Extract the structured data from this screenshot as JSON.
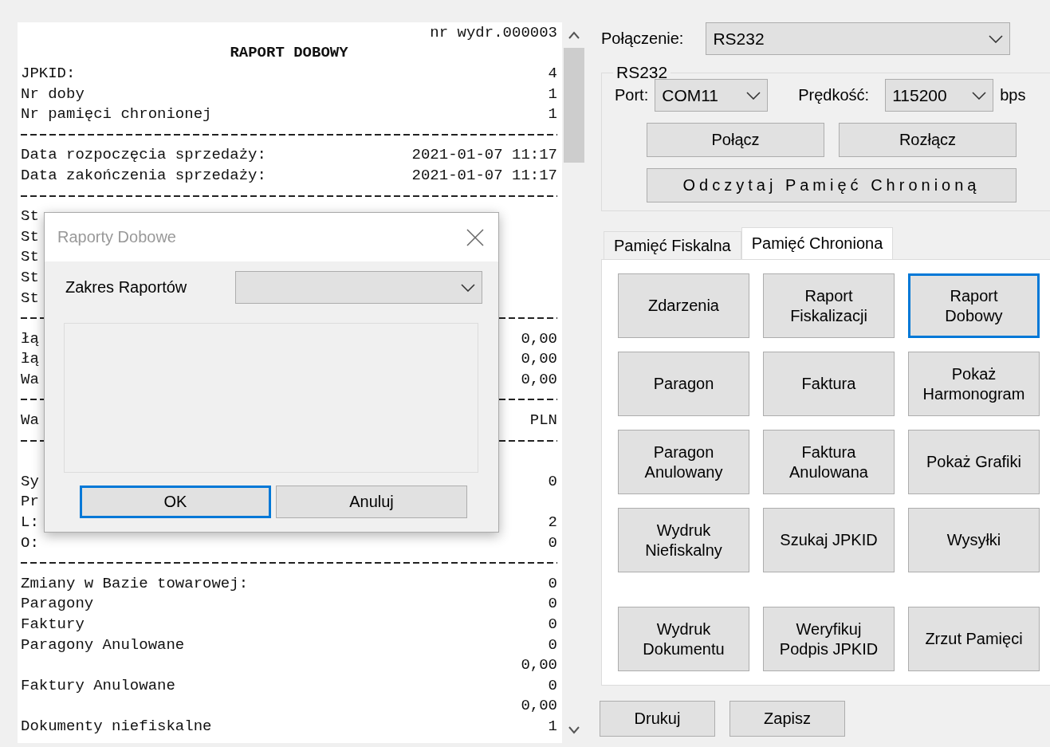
{
  "receipt": {
    "rows": [
      {
        "kind": "right",
        "label": "",
        "value": "nr wydr.000003"
      },
      {
        "kind": "center",
        "label": "RAPORT DOBOWY",
        "value": ""
      },
      {
        "kind": "line",
        "label": "JPKID:",
        "value": "4"
      },
      {
        "kind": "line",
        "label": "Nr doby",
        "value": "1"
      },
      {
        "kind": "line",
        "label": "Nr pamięci chronionej",
        "value": "1"
      },
      {
        "kind": "rule"
      },
      {
        "kind": "line",
        "label": "Data rozpoczęcia sprzedaży:",
        "value": "2021-01-07 11:17"
      },
      {
        "kind": "line",
        "label": "Data zakończenia sprzedaży:",
        "value": "2021-01-07 11:17"
      },
      {
        "kind": "rule"
      },
      {
        "kind": "line",
        "label": "St",
        "value": ""
      },
      {
        "kind": "line",
        "label": "St",
        "value": ""
      },
      {
        "kind": "line",
        "label": "St",
        "value": ""
      },
      {
        "kind": "line",
        "label": "St",
        "value": ""
      },
      {
        "kind": "line",
        "label": "St",
        "value": ""
      },
      {
        "kind": "rule"
      },
      {
        "kind": "line",
        "label": "łą",
        "value": "0,00"
      },
      {
        "kind": "line",
        "label": "łą",
        "value": "0,00"
      },
      {
        "kind": "line",
        "label": "Wa",
        "value": "0,00"
      },
      {
        "kind": "rule"
      },
      {
        "kind": "line",
        "label": "Wa",
        "value": "PLN"
      },
      {
        "kind": "rule"
      },
      {
        "kind": "blank"
      },
      {
        "kind": "line",
        "label": "Sy",
        "value": "0"
      },
      {
        "kind": "line",
        "label": "Pr",
        "value": ""
      },
      {
        "kind": "line",
        "label": "L:",
        "value": "2"
      },
      {
        "kind": "line",
        "label": "O:",
        "value": "0"
      },
      {
        "kind": "rule"
      },
      {
        "kind": "line",
        "label": "Zmiany w Bazie towarowej:",
        "value": "0"
      },
      {
        "kind": "line",
        "label": "Paragony",
        "value": "0"
      },
      {
        "kind": "line",
        "label": "Faktury",
        "value": "0"
      },
      {
        "kind": "line",
        "label": "Paragony Anulowane",
        "value": "0"
      },
      {
        "kind": "line",
        "label": "",
        "value": "0,00"
      },
      {
        "kind": "line",
        "label": "Faktury Anulowane",
        "value": "0"
      },
      {
        "kind": "line",
        "label": "",
        "value": "0,00"
      },
      {
        "kind": "line",
        "label": "Dokumenty niefiskalne",
        "value": "1"
      }
    ]
  },
  "dialog": {
    "title": "Raporty Dobowe",
    "range_label": "Zakres Raportów",
    "buttons": [
      {
        "label": "OK",
        "focused": true
      },
      {
        "label": "Anuluj",
        "focused": false
      }
    ]
  },
  "connection": {
    "label": "Połączenie:",
    "value": "RS232"
  },
  "rs232": {
    "title": "RS232",
    "port_label": "Port:",
    "port": "COM11",
    "speed_label": "Prędkość:",
    "speed": "115200",
    "unit": "bps",
    "buttons": [
      "Połącz",
      "Rozłącz"
    ],
    "read_button": "Odczytaj Pamięć Chronioną"
  },
  "tabs": [
    {
      "label": "Pamięć Fiskalna",
      "selected": false
    },
    {
      "label": "Pamięć Chroniona",
      "selected": true
    }
  ],
  "function_buttons": [
    {
      "label": "Zdarzenia",
      "focused": false
    },
    {
      "label": "Raport\nFiskalizacji",
      "focused": false
    },
    {
      "label": "Raport\nDobowy",
      "focused": true
    },
    {
      "label": "Paragon",
      "focused": false
    },
    {
      "label": "Faktura",
      "focused": false
    },
    {
      "label": "Pokaż\nHarmonogram",
      "focused": false
    },
    {
      "label": "Paragon\nAnulowany",
      "focused": false
    },
    {
      "label": "Faktura\nAnulowana",
      "focused": false
    },
    {
      "label": "Pokaż Grafiki",
      "focused": false
    },
    {
      "label": "Wydruk\nNiefiskalny",
      "focused": false
    },
    {
      "label": "Szukaj JPKID",
      "focused": false
    },
    {
      "label": "Wysyłki",
      "focused": false
    },
    {
      "label": "Wydruk\nDokumentu",
      "focused": false
    },
    {
      "label": "Weryfikuj\nPodpis JPKID",
      "focused": false
    },
    {
      "label": "Zrzut Pamięci",
      "focused": false
    }
  ],
  "bottom_buttons": [
    "Drukuj",
    "Zapisz"
  ]
}
